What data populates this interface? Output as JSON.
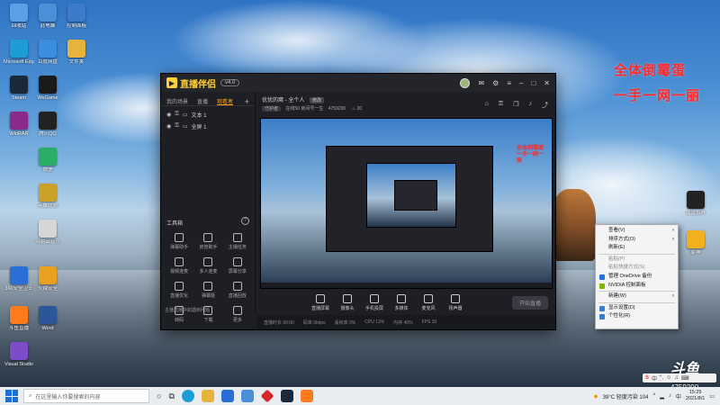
{
  "desktop": {
    "icons": [
      {
        "label": "回收站",
        "icon": "recycle-bin-icon",
        "color": "#5aa0e6"
      },
      {
        "label": "此电脑",
        "icon": "this-pc-icon",
        "color": "#4a8fd8"
      },
      {
        "label": "控制面板",
        "icon": "control-panel-icon",
        "color": "#3b7bc9"
      },
      {
        "label": "Microsoft Edge",
        "icon": "edge-icon",
        "color": "#1d9cd6"
      },
      {
        "label": "Steam",
        "icon": "steam-icon",
        "color": "#1b2838"
      },
      {
        "label": "WeGame",
        "icon": "wegame-icon",
        "color": "#1a1a1a"
      },
      {
        "label": "WinRAR",
        "icon": "winrar-icon",
        "color": "#8b2a8b"
      },
      {
        "label": "腾讯QQ",
        "icon": "qq-icon",
        "color": "#222222"
      },
      {
        "label": "微信",
        "icon": "wechat-icon",
        "color": "#2aae67"
      },
      {
        "label": "英雄联盟",
        "icon": "lol-icon",
        "color": "#c9a227"
      },
      {
        "label": "Word",
        "icon": "word-icon",
        "color": "#2b579a"
      },
      {
        "label": "斗鱼直播",
        "icon": "douyu-icon",
        "color": "#ff7a1a"
      },
      {
        "label": "360安全卫士",
        "icon": "security-icon",
        "color": "#2a6fd6"
      },
      {
        "label": "火绒安全",
        "icon": "shield-icon",
        "color": "#e8a020"
      },
      {
        "label": "百度网盘",
        "icon": "cloud-disk-icon",
        "color": "#3b8de0"
      },
      {
        "label": "文件夹",
        "icon": "folder-icon",
        "color": "#e6b33c"
      },
      {
        "label": "Visual Studio",
        "icon": "vs-icon",
        "color": "#7d4cc9"
      },
      {
        "label": "网易云音乐",
        "icon": "music-icon",
        "color": "#d6d6d6"
      }
    ],
    "right_icons": [
      {
        "label": "魔兽世界",
        "icon": "wow-icon",
        "color": "#222222"
      },
      {
        "label": "原神",
        "icon": "genshin-icon",
        "color": "#f2b01e"
      }
    ]
  },
  "annotation": {
    "line1": "全体倒霉蛋",
    "line2": "一手一网一丽"
  },
  "app": {
    "title": "直播伴侣",
    "version": "v4.0",
    "tabs": [
      "我的场景",
      "直播",
      "观看者"
    ],
    "active_tab": "观看者",
    "sources": [
      {
        "label": "文本 1"
      },
      {
        "label": "全屏 1"
      }
    ],
    "tools_title": "工具箱",
    "tools": [
      "弹幕助手",
      "房管助手",
      "主播任务",
      "视频连麦",
      "多人连麦",
      "屏幕分享",
      "直播优化",
      "弹幕姬",
      "直播回放",
      "转码",
      "下载",
      "更多"
    ],
    "notice": "主播直播中如遇到问题",
    "stream_title": "优优的窝 - 全个人",
    "stream_tag": "修改",
    "stream_sub_chip": "守护者",
    "stream_info": "在线50 房间号一生",
    "room_id": "4759290",
    "fans": "20",
    "preview_annotation": "全体倒霉蛋一手一网一丽",
    "bottom_buttons": [
      {
        "label": "直播屏幕",
        "icon": "screen-icon"
      },
      {
        "label": "摄像头",
        "icon": "camera-icon"
      },
      {
        "label": "手机投屏",
        "icon": "phone-icon"
      },
      {
        "label": "多媒体",
        "icon": "media-icon"
      },
      {
        "label": "麦克风",
        "icon": "mic-icon"
      },
      {
        "label": "扬声器",
        "icon": "speaker-icon"
      }
    ],
    "start_label": "开始直播",
    "status": [
      "直播时长 00:00",
      "码率 0kbps",
      "丢帧率 0%",
      "CPU 13%",
      "内存 40%",
      "FPS 30"
    ]
  },
  "context_menu": {
    "items": [
      {
        "label": "查看(V)",
        "arrow": true,
        "disabled": false
      },
      {
        "label": "排序方式(O)",
        "arrow": true,
        "disabled": false
      },
      {
        "label": "刷新(E)",
        "arrow": false,
        "disabled": false
      },
      {
        "sep": true
      },
      {
        "label": "粘贴(P)",
        "arrow": false,
        "disabled": true
      },
      {
        "label": "粘贴快捷方式(S)",
        "arrow": false,
        "disabled": true
      },
      {
        "label": "管理 OneDrive 备份",
        "arrow": false,
        "disabled": false,
        "icon_color": "#1e74d8"
      },
      {
        "label": "NVIDIA 控制面板",
        "arrow": false,
        "disabled": false,
        "icon_color": "#76b900"
      },
      {
        "sep": true
      },
      {
        "label": "新建(W)",
        "arrow": true,
        "disabled": false
      },
      {
        "sep": true
      },
      {
        "label": "显示设置(D)",
        "arrow": false,
        "disabled": false,
        "icon_color": "#3b7bc9"
      },
      {
        "label": "个性化(R)",
        "arrow": false,
        "disabled": false,
        "icon_color": "#3b7bc9"
      }
    ]
  },
  "overlay": {
    "brand": "斗鱼",
    "room_number": "4759290",
    "ime_label": "中"
  },
  "taskbar": {
    "search_placeholder": "在这里输入你要搜索的内容",
    "weather": "39°C 轻度污染 104",
    "time": "15:25",
    "date": "2021/8/1",
    "ime": "中"
  }
}
